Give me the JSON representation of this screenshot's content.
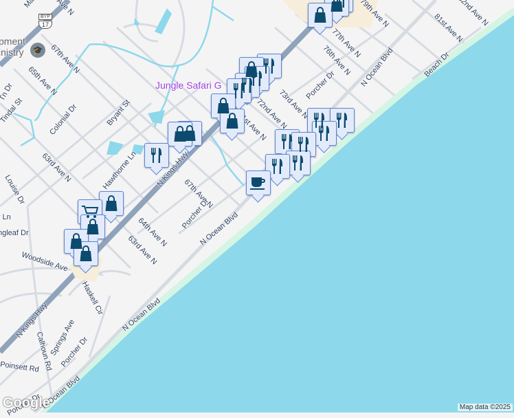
{
  "map": {
    "colors": {
      "water": "#8dd8eb",
      "beach": "#d4f5e4",
      "land": "#f5f4f5",
      "highway": "#8fa3bb",
      "road": "#d6dbe2",
      "pin_icon": "#0d4b6e",
      "poi": "#9c3fe0"
    },
    "highway_shield": {
      "top": "BYP",
      "number": "17"
    },
    "labels": [
      "Ma",
      "67th Ave N",
      "65th Ave N",
      "Tindal St",
      "Colonial Dr",
      "Bryant St",
      "63rd Ave N",
      "Hawthorne Ln",
      "N Kings Hwy",
      "67th Ave N",
      "Porcher Dr",
      "64th Ave N",
      "63rd Ave N",
      "N Ocean Blvd",
      "Woodside Ave",
      "Haskell Cir",
      "N Kings Hwy",
      "Springs Ave",
      "Calhoun Rd",
      "Poinsett Rd",
      "Porcher Dr",
      "N Ocean Blvd",
      "N Ocean Blvd",
      "Porcher Dr",
      "72nd Ave N",
      "71st Ave N",
      "73rd Ave N",
      "Porcher Dr",
      "76th Ave N",
      "77th Ave N",
      "79th Ave N",
      "N Ocean Blvd",
      "81st Ave N",
      "82nd Ave N",
      "Beach Dr",
      "Tn Dr",
      "Louise Dr",
      "y Ln",
      "ngleaf Dr",
      "th Ave N"
    ],
    "poi_label": "Jungle Safari G",
    "ministry_label": "pment\ninistry",
    "pins": [
      "restaurant",
      "shopping",
      "shopping",
      "restaurant",
      "shopping",
      "restaurant",
      "restaurant",
      "restaurant",
      "shopping",
      "shopping",
      "shopping",
      "shopping",
      "restaurant",
      "restaurant",
      "restaurant",
      "restaurant",
      "restaurant",
      "restaurant",
      "restaurant",
      "restaurant",
      "coffee",
      "shopping",
      "cart",
      "shopping",
      "shopping",
      "shopping"
    ],
    "logo": "Google",
    "attribution": "Map data ©2025"
  }
}
